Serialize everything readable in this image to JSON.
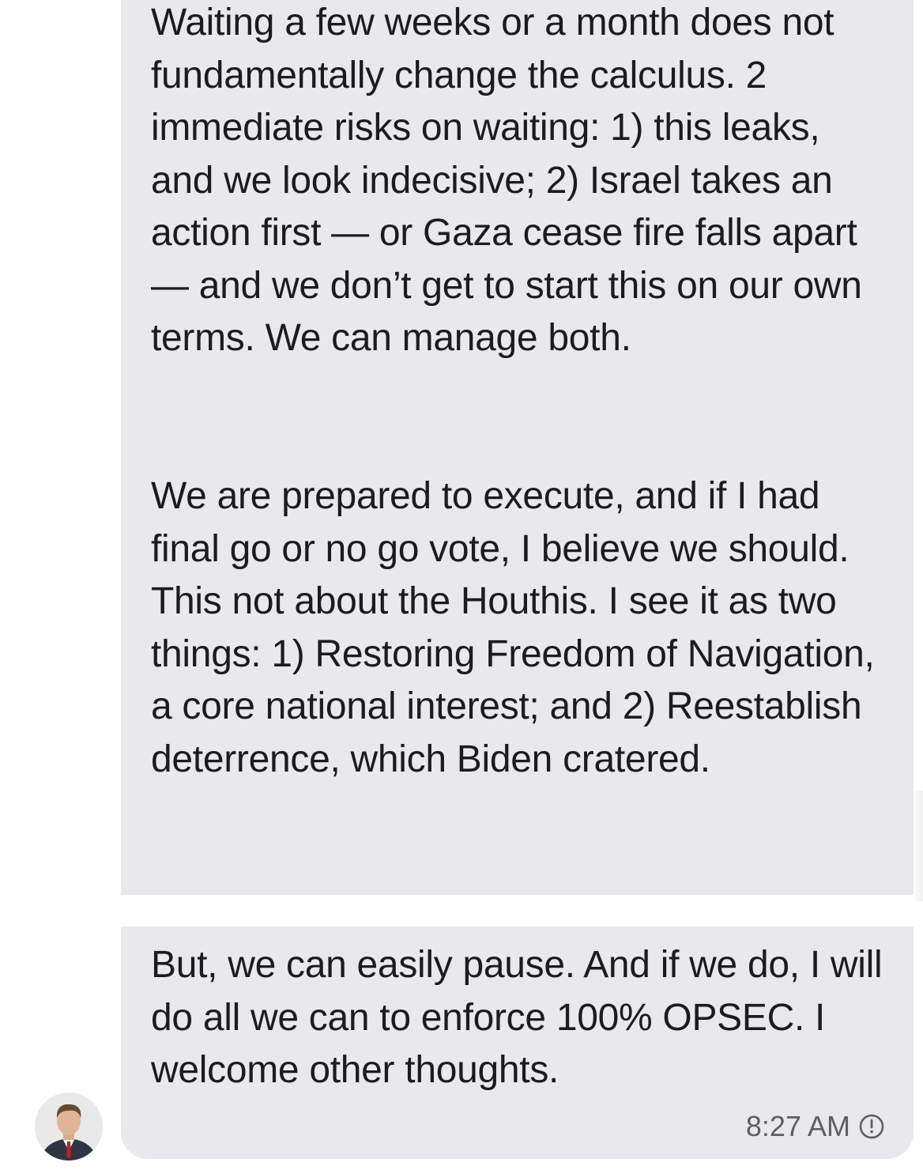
{
  "messages": [
    {
      "paragraphs": [
        "Waiting a few weeks or a month does not fundamentally change the calculus. 2 immediate risks on waiting: 1) this leaks, and we look indecisive; 2) Israel takes an action first — or Gaza cease fire falls apart — and we don’t get to start this on our own terms. We can manage both.",
        "We are prepared to execute, and if I had final go or no go vote, I believe we should. This not about the Houthis. I see it as two things: 1) Restoring Freedom of Navigation, a core national interest; and 2) Reestablish deterrence, which Biden cratered."
      ]
    },
    {
      "paragraphs": [
        "But, we can easily pause. And if we do, I will do all we can to enforce 100% OPSEC. I welcome other thoughts."
      ],
      "timestamp": "8:27 AM",
      "status_icon": "clock-icon"
    }
  ],
  "sender": {
    "avatar_icon": "avatar-photo"
  },
  "colors": {
    "bubble_bg": "#e9e9eb",
    "text": "#1c1c1e",
    "timestamp": "#5f5f63"
  }
}
